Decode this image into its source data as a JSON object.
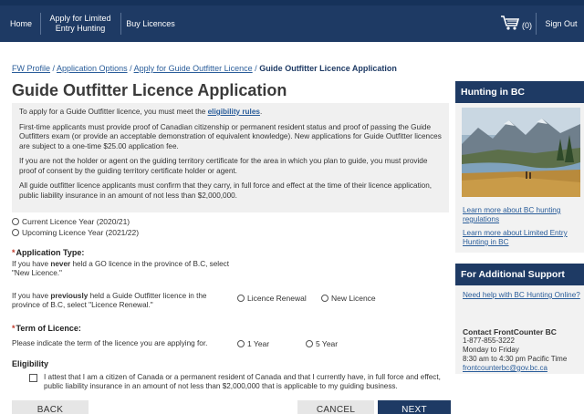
{
  "nav": {
    "home": "Home",
    "apply_line1": "Apply for Limited",
    "apply_line2": "Entry Hunting",
    "buy": "Buy Licences",
    "cart_count": "(0)",
    "signout": "Sign Out"
  },
  "breadcrumb": {
    "link1": "FW Profile",
    "sep": " / ",
    "link2": "Application Options",
    "link3": "Apply for Guide Outfitter Licence",
    "current": "Guide Outfitter Licence Application"
  },
  "title": "Guide Outfitter Licence Application",
  "info": {
    "p1_before": "To apply for a Guide Outfitter licence, you must meet the ",
    "p1_link": "eligibility rules",
    "p1_after": ".",
    "p2": "First-time applicants must provide proof of Canadian citizenship or permanent resident status and proof of passing the Guide Outfitters exam (or provide an acceptable demonstration of equivalent knowledge). New applications for Guide Outfitter licences are subject to a one-time $25.00 application fee.",
    "p3": "If you are not the holder or agent on the guiding territory certificate for the area in which you plan to guide, you must provide proof of consent by the guiding territory certificate holder or agent.",
    "p4": "All guide outfitter licence applicants must confirm that they carry, in full force and effect at the time of their licence application, public liability insurance in an amount of not less than $2,000,000."
  },
  "years": {
    "current": "Current Licence Year (2020/21)",
    "upcoming": "Upcoming Licence Year (2021/22)"
  },
  "application_type": {
    "heading": "Application Type:",
    "never_1": "If you have ",
    "never_bold": "never",
    "never_2": " held a GO licence in the province of B.C, select \"New Licence.\"",
    "prev_1": "If you have ",
    "prev_bold": "previously",
    "prev_2": " held a Guide Outfitter licence in the province of B.C, select \"Licence Renewal.\"",
    "renewal": "Licence Renewal",
    "new": "New Licence"
  },
  "term": {
    "heading": "Term of Licence:",
    "text": "Please indicate the term of the licence you are applying for.",
    "one": "1 Year",
    "five": "5 Year"
  },
  "eligibility": {
    "heading": "Eligibility",
    "attest": "I attest that I am a citizen of Canada or a permanent resident of Canada and that I currently have, in full force and effect, public liability insurance in an amount of not less than $2,000,000 that is applicable to my guiding business."
  },
  "buttons": {
    "back": "BACK",
    "cancel": "CANCEL",
    "next": "NEXT"
  },
  "sidebar": {
    "hunting_title": "Hunting in BC",
    "link_regs": "Learn more about BC hunting regulations",
    "link_lee": "Learn more about Limited Entry Hunting in BC",
    "support_title": "For Additional Support",
    "link_help": "Need help with BC Hunting Online?",
    "contact_title": "Contact FrontCounter BC",
    "phone": "1-877-855-3222",
    "days": "Monday to Friday",
    "hours": "8:30 am to 4:30 pm Pacific Time",
    "email": "frontcounterbc@gov.bc.ca"
  },
  "colors": {
    "nav_bg": "#1e3a64",
    "link": "#2a5d9a",
    "required": "#c0392b",
    "panel_bg": "#f0f0f0"
  }
}
